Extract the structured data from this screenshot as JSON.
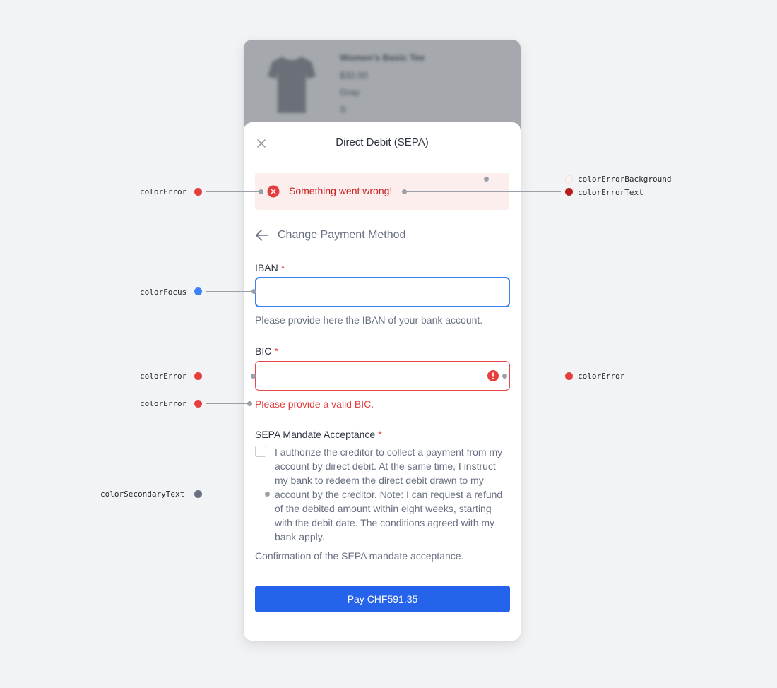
{
  "product": {
    "name": "Women's Basic Tee",
    "price": "$32.00",
    "color": "Gray",
    "size": "S"
  },
  "sheet": {
    "title": "Direct Debit (SEPA)",
    "close_icon": "close-icon"
  },
  "alert": {
    "icon": "error-circle-icon",
    "text": "Something went wrong!"
  },
  "back": {
    "icon": "arrow-left-icon",
    "label": "Change Payment Method"
  },
  "iban": {
    "label": "IBAN",
    "required_mark": "*",
    "value": "",
    "help": "Please provide here the IBAN of your bank account."
  },
  "bic": {
    "label": "BIC",
    "required_mark": "*",
    "value": "",
    "error_icon": "exclamation-icon",
    "error": "Please provide a valid BIC."
  },
  "mandate": {
    "label": "SEPA Mandate Acceptance",
    "required_mark": "*",
    "checked": false,
    "text": "I authorize the creditor to collect a payment from my account by direct debit. At the same time, I instruct my bank to redeem the direct debit drawn to my account by the creditor. Note: I can request a refund of the debited amount within eight weeks, starting with the debit date. The conditions agreed with my bank apply.",
    "help": "Confirmation of the SEPA mandate acceptance."
  },
  "pay_button": {
    "label": "Pay CHF591.35"
  },
  "annotations": {
    "alert_icon_left": "colorError",
    "error_background": "colorErrorBackground",
    "error_text": "colorErrorText",
    "focus": "colorFocus",
    "bic_field_left": "colorError",
    "bic_icon_right": "colorError",
    "bic_message": "colorError",
    "secondary_text": "colorSecondaryText"
  },
  "colors": {
    "colorError": "#e53e3e",
    "colorErrorBackground": "#fdeeee",
    "colorErrorText": "#c81e1e",
    "colorFocus": "#3b82f6",
    "colorSecondaryText": "#687081",
    "primary": "#2563eb"
  }
}
